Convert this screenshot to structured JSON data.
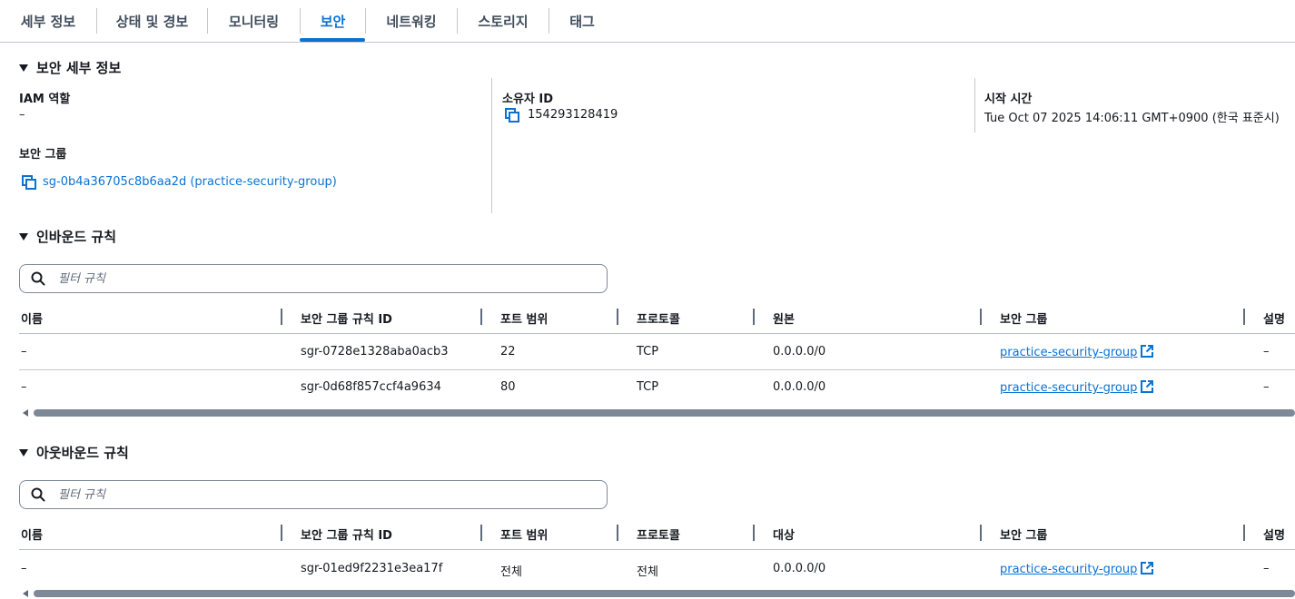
{
  "tabs": [
    {
      "label": "세부 정보"
    },
    {
      "label": "상태 및 경보"
    },
    {
      "label": "모니터링"
    },
    {
      "label": "보안"
    },
    {
      "label": "네트워킹"
    },
    {
      "label": "스토리지"
    },
    {
      "label": "태그"
    }
  ],
  "active_tab": "보안",
  "security_details": {
    "title": "보안 세부 정보",
    "iam_role_label": "IAM 역할",
    "iam_role_value": "–",
    "owner_id_label": "소유자 ID",
    "owner_id_value": "154293128419",
    "launch_time_label": "시작 시간",
    "launch_time_value": "Tue Oct 07 2025 14:06:11 GMT+0900 (한국 표준시)",
    "security_groups_label": "보안 그룹",
    "security_group_link": "sg-0b4a36705c8b6aa2d (practice-security-group)"
  },
  "inbound": {
    "title": "인바운드 규칙",
    "filter_placeholder": "필터 규칙",
    "columns": [
      "이름",
      "보안 그룹 규칙 ID",
      "포트 범위",
      "프로토콜",
      "원본",
      "보안 그룹",
      "설명"
    ],
    "rows": [
      {
        "name": "–",
        "rule_id": "sgr-0728e1328aba0acb3",
        "port": "22",
        "protocol": "TCP",
        "source": "0.0.0.0/0",
        "sg": "practice-security-group",
        "desc": "–"
      },
      {
        "name": "–",
        "rule_id": "sgr-0d68f857ccf4a9634",
        "port": "80",
        "protocol": "TCP",
        "source": "0.0.0.0/0",
        "sg": "practice-security-group",
        "desc": "–"
      }
    ]
  },
  "outbound": {
    "title": "아웃바운드 규칙",
    "filter_placeholder": "필터 규칙",
    "columns": [
      "이름",
      "보안 그룹 규칙 ID",
      "포트 범위",
      "프로토콜",
      "대상",
      "보안 그룹",
      "설명"
    ],
    "rows": [
      {
        "name": "–",
        "rule_id": "sgr-01ed9f2231e3ea17f",
        "port": "전체",
        "protocol": "전체",
        "dest": "0.0.0.0/0",
        "sg": "practice-security-group",
        "desc": "–"
      }
    ]
  },
  "colors": {
    "link": "#0972d3",
    "text": "#16191f",
    "border": "#c6c6cd"
  }
}
